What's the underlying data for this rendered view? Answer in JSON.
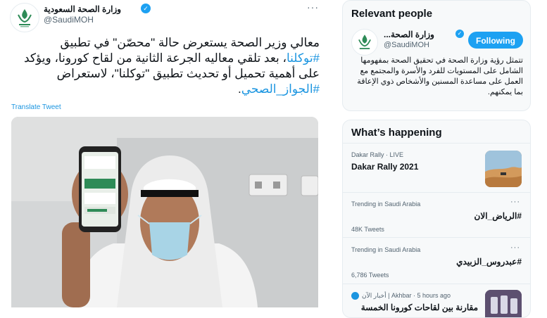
{
  "tweet": {
    "author_name": "وزارة الصحة السعودية",
    "author_handle": "@SaudiMOH",
    "more_icon": "ellipsis-icon",
    "text_line1": "معالي وزير الصحة يستعرض حالة \"محصّن\" في تطبيق",
    "hashtag1": "#توكلنا",
    "text_line2": "، بعد تلقي معاليه الجرعة الثانية من لقاح كورونا، ويؤكد",
    "text_line3": "على أهمية تحميل أو تحديث تطبيق \"توكلنا\"، لاستعراض",
    "hashtag2": "#الجواز_الصحي",
    "text_end": ".",
    "translate_label": "Translate Tweet"
  },
  "relevant_people": {
    "title": "Relevant people",
    "name": "وزارة الصحة...",
    "handle": "@SaudiMOH",
    "follow_label": "Following",
    "bio": "تتمثل رؤية وزارة الصحة في تحقيق الصحة بمفهومها الشامل على المستويات للفرد والأسرة والمجتمع مع العمل على مساعدة المسنين والأشخاص ذوي الإعاقة بما يمكنهم."
  },
  "whats_happening": {
    "title": "What’s happening",
    "trends": [
      {
        "category": "Dakar Rally · LIVE",
        "title": "Dakar Rally 2021",
        "count": ""
      },
      {
        "category": "Trending in Saudi Arabia",
        "title": "#الرياض_الان",
        "count": "48K Tweets"
      },
      {
        "category": "Trending in Saudi Arabia",
        "title": "#عبدروس_الزبيدي",
        "count": "6,786 Tweets"
      },
      {
        "category": "أخبار الآن | Akhbar · 5 hours ago",
        "title": "مقارنة بين لقاحات كورونا الخمسة",
        "count": ""
      }
    ]
  },
  "colors": {
    "accent": "#1da1f2",
    "link": "#1b95e0",
    "text": "#0f1419",
    "muted": "#536471"
  }
}
